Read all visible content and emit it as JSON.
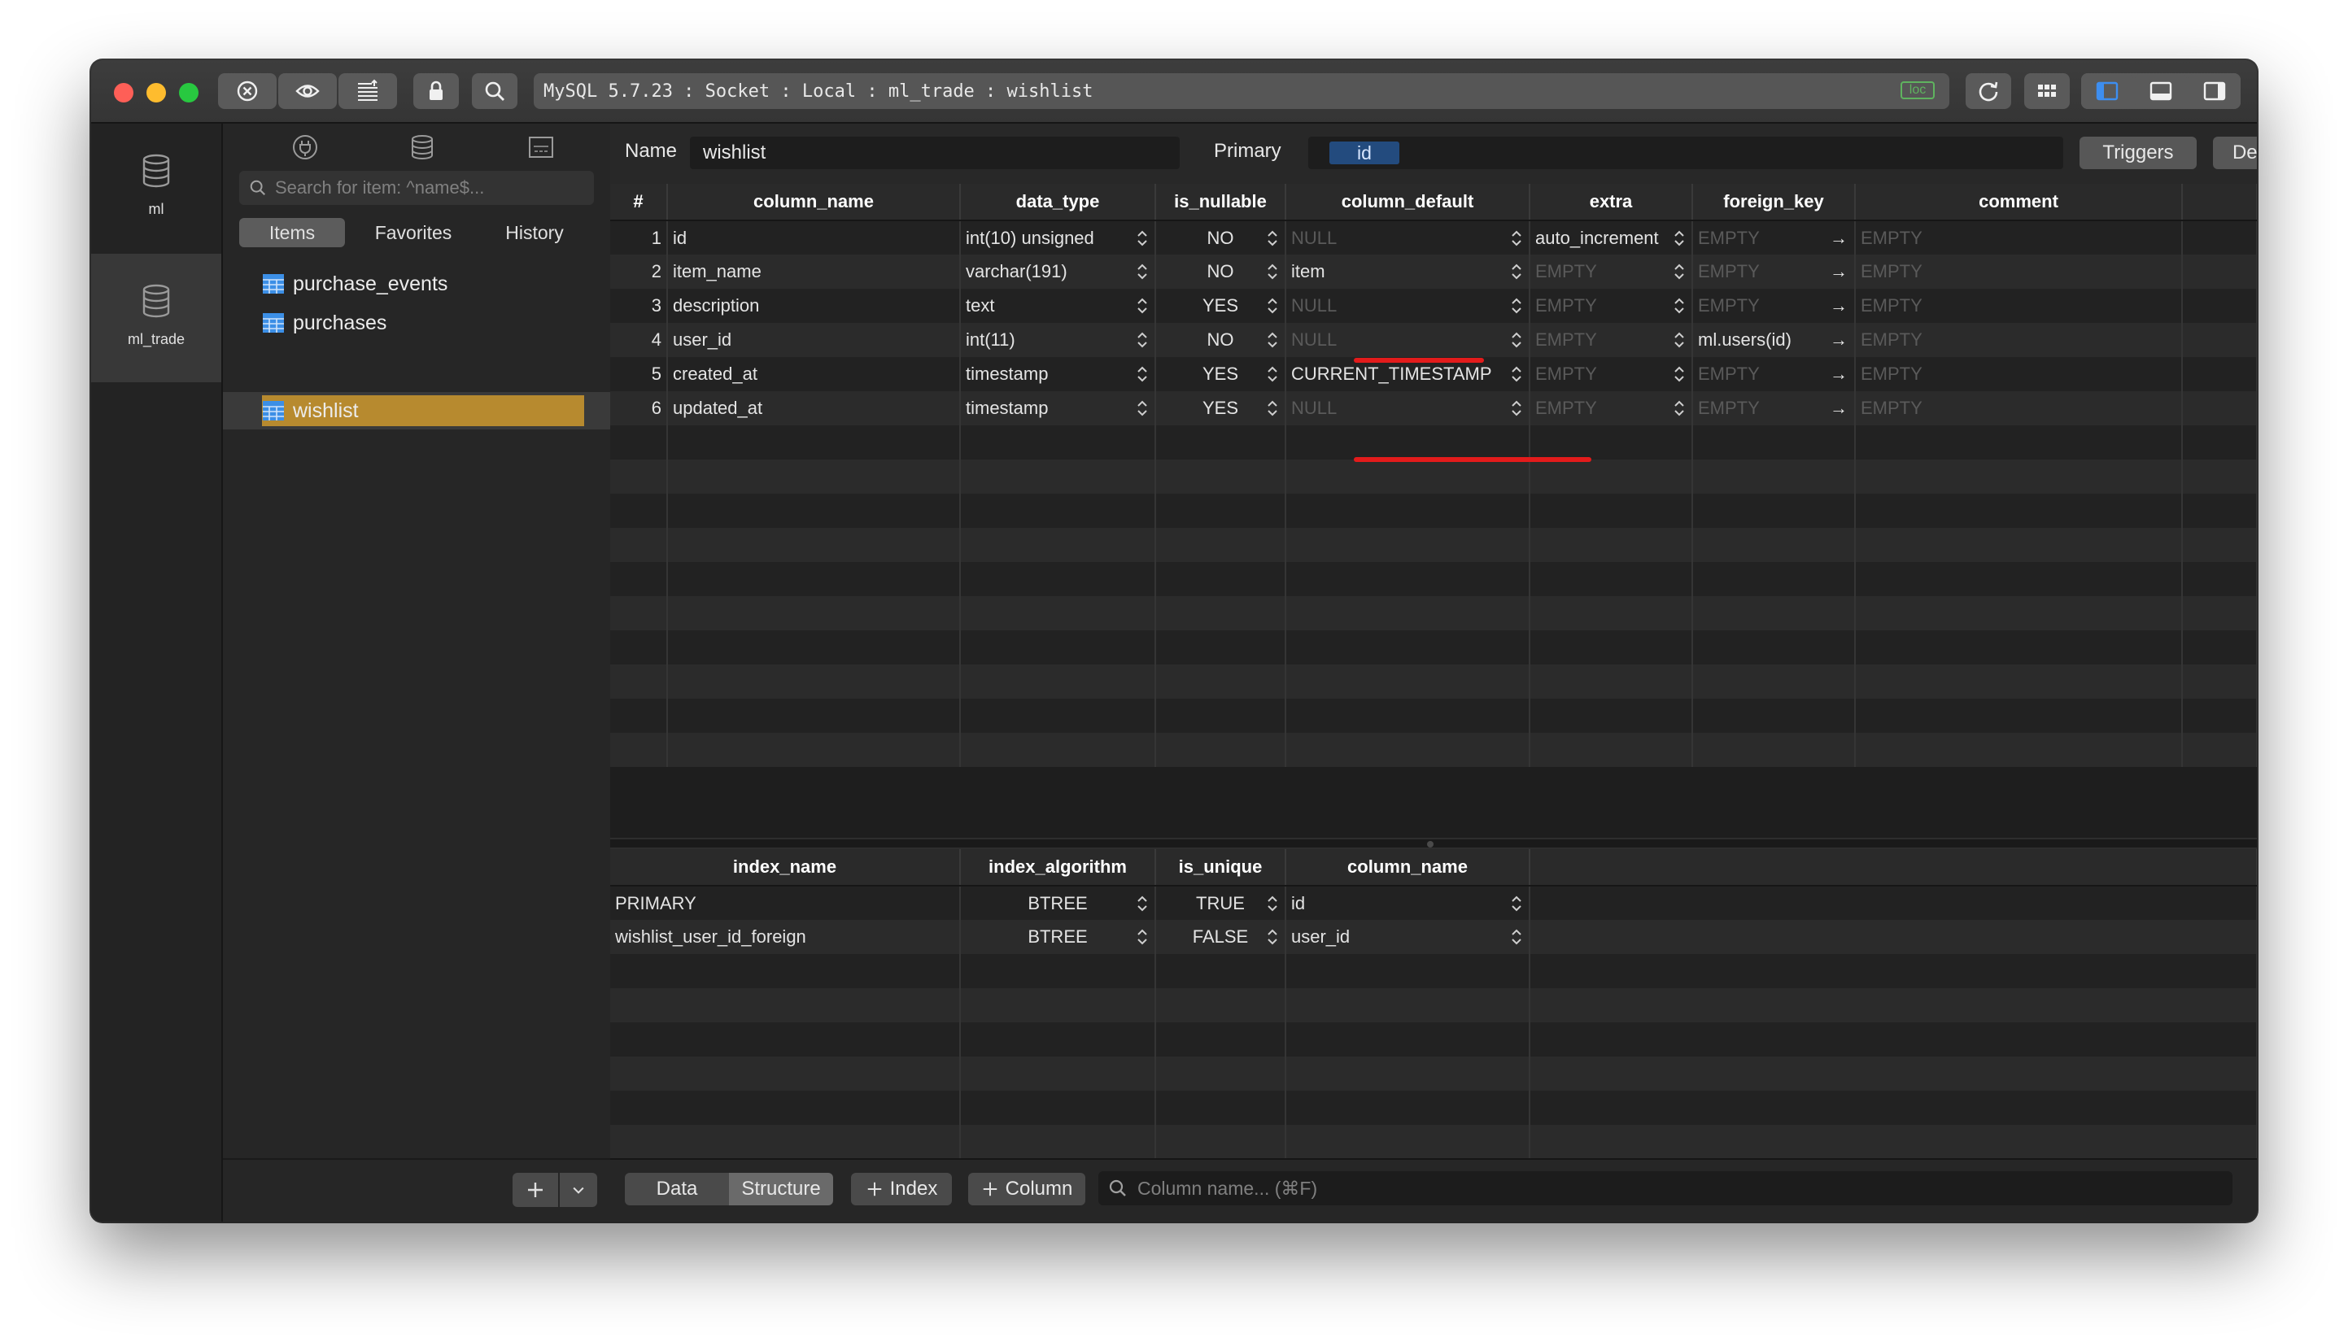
{
  "titlebar": {
    "connection": "MySQL 5.7.23 : Socket : Local : ml_trade : wishlist",
    "loc_badge": "loc"
  },
  "databases": [
    {
      "label": "ml"
    },
    {
      "label": "ml_trade"
    }
  ],
  "items_panel": {
    "search_placeholder": "Search for item: ^name$...",
    "tabs": [
      "Items",
      "Favorites",
      "History"
    ],
    "tables": [
      "purchase_events",
      "purchases",
      "wishlist"
    ]
  },
  "header": {
    "name_label": "Name",
    "name_value": "wishlist",
    "primary_label": "Primary",
    "primary_value": "id",
    "triggers_button": "Triggers",
    "definition_button": "Definition"
  },
  "columns_table": {
    "headers": [
      "#",
      "column_name",
      "data_type",
      "is_nullable",
      "column_default",
      "extra",
      "foreign_key",
      "comment"
    ],
    "rows": [
      {
        "num": "1",
        "name": "id",
        "type": "int(10) unsigned",
        "nullable": "NO",
        "default": "NULL",
        "extra": "auto_increment",
        "fk": "EMPTY",
        "comment": "EMPTY"
      },
      {
        "num": "2",
        "name": "item_name",
        "type": "varchar(191)",
        "nullable": "NO",
        "default": "item",
        "extra": "EMPTY",
        "fk": "EMPTY",
        "comment": "EMPTY"
      },
      {
        "num": "3",
        "name": "description",
        "type": "text",
        "nullable": "YES",
        "default": "NULL",
        "extra": "EMPTY",
        "fk": "EMPTY",
        "comment": "EMPTY"
      },
      {
        "num": "4",
        "name": "user_id",
        "type": "int(11)",
        "nullable": "NO",
        "default": "NULL",
        "extra": "EMPTY",
        "fk": "ml.users(id)",
        "comment": "EMPTY"
      },
      {
        "num": "5",
        "name": "created_at",
        "type": "timestamp",
        "nullable": "YES",
        "default": "CURRENT_TIMESTAMP",
        "extra": "EMPTY",
        "fk": "EMPTY",
        "comment": "EMPTY"
      },
      {
        "num": "6",
        "name": "updated_at",
        "type": "timestamp",
        "nullable": "YES",
        "default": "NULL",
        "extra": "EMPTY",
        "fk": "EMPTY",
        "comment": "EMPTY"
      }
    ]
  },
  "index_table": {
    "headers": [
      "index_name",
      "index_algorithm",
      "is_unique",
      "column_name"
    ],
    "rows": [
      {
        "name": "PRIMARY",
        "algorithm": "BTREE",
        "unique": "TRUE",
        "column": "id"
      },
      {
        "name": "wishlist_user_id_foreign",
        "algorithm": "BTREE",
        "unique": "FALSE",
        "column": "user_id"
      }
    ]
  },
  "footer": {
    "data_tab": "Data",
    "structure_tab": "Structure",
    "index_button": "Index",
    "column_button": "Column",
    "column_search_placeholder": "Column name... (⌘F)"
  },
  "colors": {
    "selected_table": "#b78a2f",
    "primary_chip": "#234b7e",
    "annotation_red": "#e31b1b",
    "loc_green": "#5fb35f"
  }
}
